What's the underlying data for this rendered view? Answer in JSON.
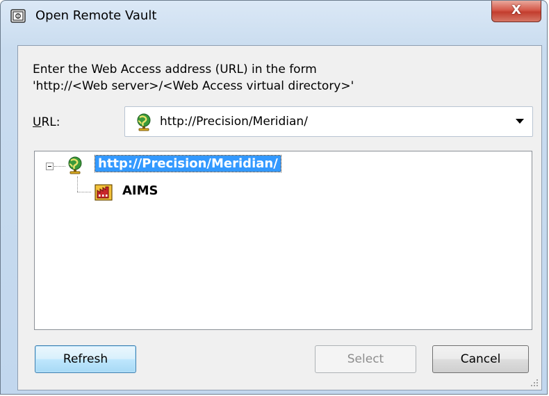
{
  "window": {
    "title": "Open Remote Vault",
    "close_glyph": "X"
  },
  "instructions": {
    "line1": "Enter the Web Access address (URL) in the form",
    "line2": "'http://<Web server>/<Web Access virtual directory>'"
  },
  "url_field": {
    "label_mnemonic": "U",
    "label_rest": "RL:",
    "value": "http://Precision/Meridian/",
    "icon": "globe-icon"
  },
  "tree": {
    "root": {
      "label": "http://Precision/Meridian/",
      "icon": "globe-icon",
      "expanded": true,
      "selected": true
    },
    "children": [
      {
        "label": "AIMS",
        "icon": "vault-icon"
      }
    ]
  },
  "buttons": {
    "refresh": "Refresh",
    "select": "Select",
    "cancel": "Cancel"
  },
  "colors": {
    "selection": "#3399ff",
    "close_button": "#c23d2e"
  }
}
